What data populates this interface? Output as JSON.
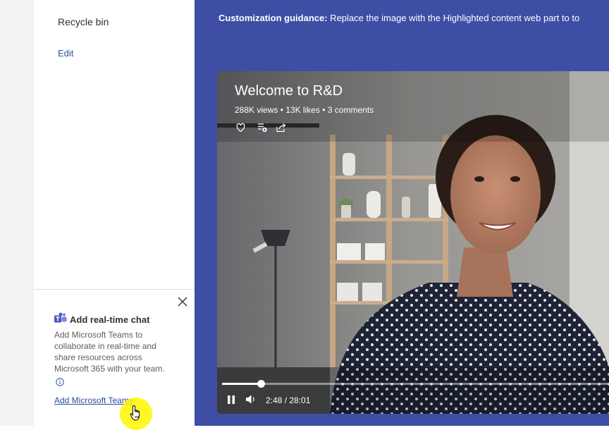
{
  "nav": {
    "recycle_bin": "Recycle bin",
    "edit": "Edit"
  },
  "teams_card": {
    "title": "Add real-time chat",
    "description": "Add Microsoft Teams to collaborate in real-time and share resources across Microsoft 365 with your team.",
    "link": "Add Microsoft Teams"
  },
  "main": {
    "guidance_label": "Customization guidance:",
    "guidance_text": " Replace the image with the Highlighted content web part to to"
  },
  "video": {
    "title": "Welcome to R&D",
    "stats": "288K views • 13K likes • 3 comments",
    "time": "2:48 / 28:01",
    "progress_fraction": 0.1
  },
  "colors": {
    "main_bg": "#3e4ea5",
    "teams_purple": "#5059c9",
    "link": "#2b4c9a"
  },
  "icons": [
    "close-icon",
    "teams-icon",
    "info-icon",
    "heart-icon",
    "add-to-playlist-icon",
    "share-icon",
    "pause-icon",
    "volume-icon",
    "hand-cursor-icon"
  ]
}
